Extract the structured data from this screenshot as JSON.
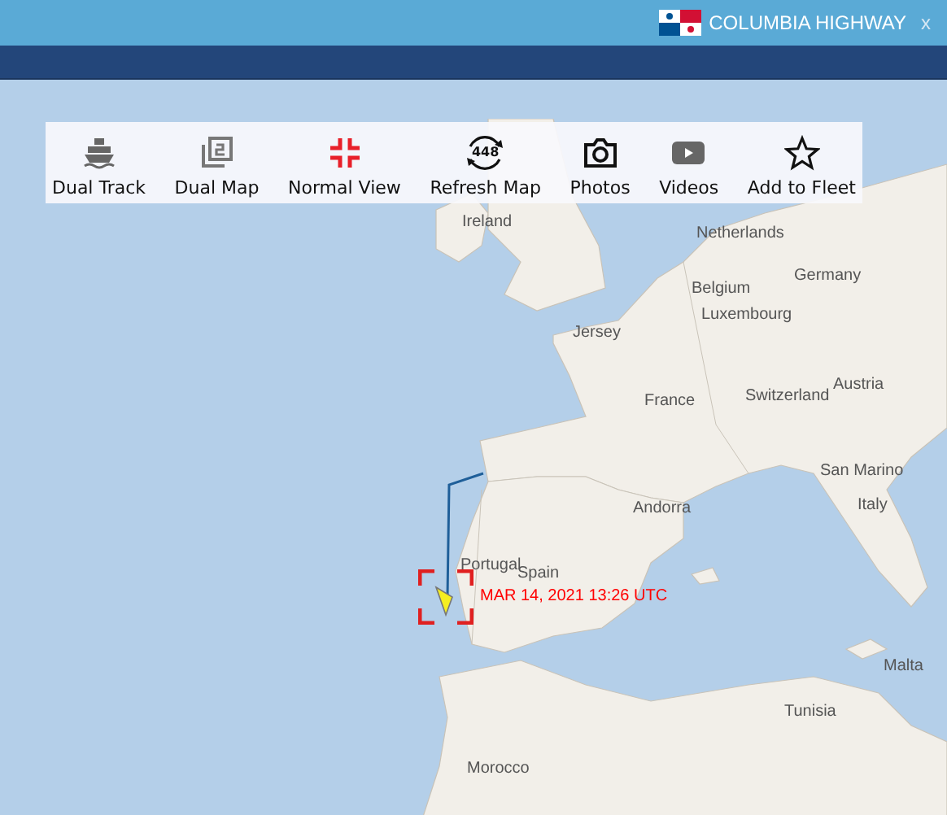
{
  "header": {
    "vessel_name": "COLUMBIA HIGHWAY",
    "close": "x"
  },
  "toolbar": [
    {
      "kind": "ship",
      "label": "Dual Track"
    },
    {
      "kind": "dualmap",
      "label": "Dual Map"
    },
    {
      "kind": "normalview",
      "label": "Normal View"
    },
    {
      "kind": "refresh",
      "label": "Refresh Map",
      "badge": "448"
    },
    {
      "kind": "camera",
      "label": "Photos"
    },
    {
      "kind": "video",
      "label": "Videos"
    },
    {
      "kind": "star",
      "label": "Add to Fleet"
    }
  ],
  "map": {
    "places": [
      "Ireland",
      "Netherlands",
      "Germany",
      "Belgium",
      "Luxembourg",
      "Jersey",
      "France",
      "Switzerland",
      "Austria",
      "Andorra",
      "San Marino",
      "Italy",
      "Portugal",
      "Spain",
      "Malta",
      "Tunisia",
      "Morocco"
    ],
    "vessel_timestamp": "MAR 14, 2021 13:26 UTC"
  }
}
